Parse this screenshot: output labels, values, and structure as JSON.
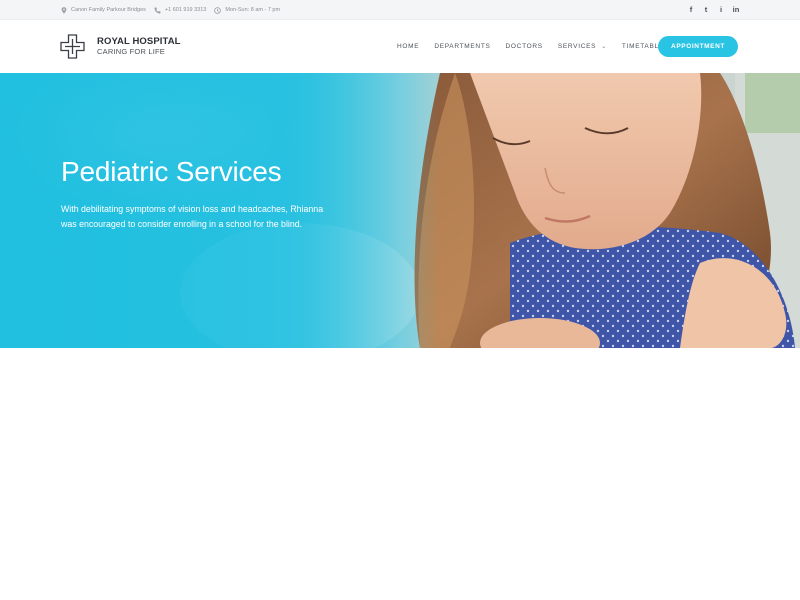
{
  "topbar": {
    "address": "Canon Family Parkour Bridges",
    "phone": "+1 601 919 3313",
    "hours": "Mon-Sun: 8 am - 7 pm",
    "social": [
      {
        "icon": "facebook-icon",
        "glyph": "f"
      },
      {
        "icon": "twitter-icon",
        "glyph": "t"
      },
      {
        "icon": "instagram-icon",
        "glyph": "i"
      },
      {
        "icon": "linkedin-icon",
        "glyph": "in"
      }
    ]
  },
  "header": {
    "brand": "ROYAL HOSPITAL",
    "tagline": "CARING FOR LIFE",
    "nav": [
      {
        "label": "HOME"
      },
      {
        "label": "DEPARTMENTS"
      },
      {
        "label": "DOCTORS"
      },
      {
        "label": "SERVICES",
        "dropdown": true
      },
      {
        "label": "TIMETABLE"
      }
    ],
    "appointment_label": "APPOINTMENT"
  },
  "hero": {
    "title": "Pediatric Services",
    "text": "With debilitating symptoms of vision loss and headcaches, Rhianna was encouraged to consider enrolling in a school for the blind."
  },
  "colors": {
    "accent": "#29c4e4",
    "topbar_bg": "#f4f5f6",
    "hero_overlay": "#21bfe0"
  }
}
